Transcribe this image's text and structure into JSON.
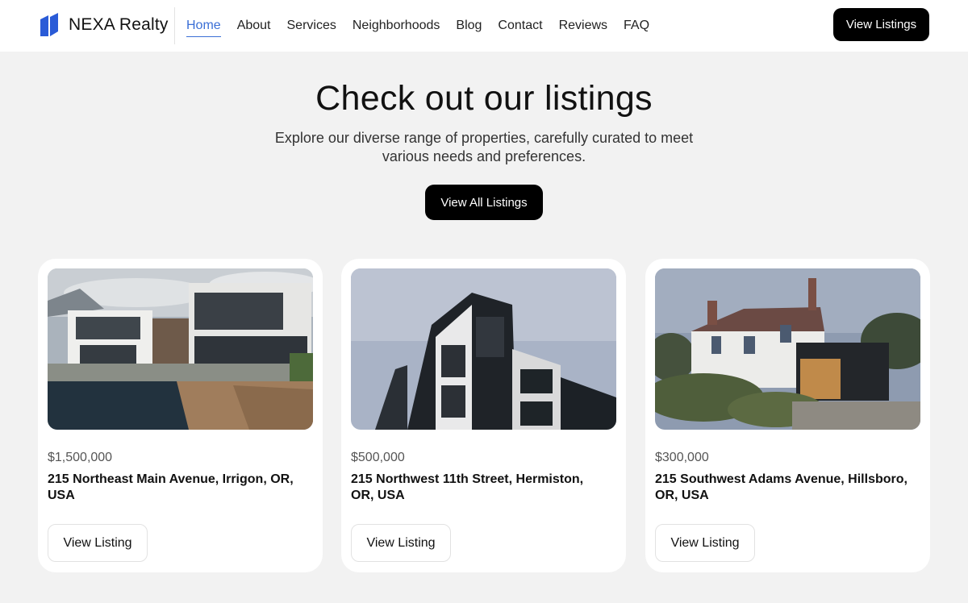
{
  "header": {
    "brand": "NEXA Realty",
    "logo_icon": "nexa-logo-icon",
    "nav": [
      {
        "label": "Home",
        "active": true
      },
      {
        "label": "About"
      },
      {
        "label": "Services"
      },
      {
        "label": "Neighborhoods"
      },
      {
        "label": "Blog"
      },
      {
        "label": "Contact"
      },
      {
        "label": "Reviews"
      },
      {
        "label": "FAQ"
      }
    ],
    "cta_label": "View Listings"
  },
  "hero": {
    "title": "Check out our listings",
    "subtitle": "Explore our diverse range of properties, carefully curated to meet various needs and preferences.",
    "cta_label": "View All Listings"
  },
  "listings": [
    {
      "price": "$1,500,000",
      "address": "215 Northeast Main Avenue, Irrigon, OR, USA",
      "button_label": "View Listing",
      "image": "modern-villa-with-pool-photo"
    },
    {
      "price": "$500,000",
      "address": "215 Northwest 11th Street, Hermiston, OR, USA",
      "button_label": "View Listing",
      "image": "modern-apartment-building-photo"
    },
    {
      "price": "$300,000",
      "address": "215 Southwest Adams Avenue, Hillsboro, OR, USA",
      "button_label": "View Listing",
      "image": "white-cottage-with-garden-photo"
    }
  ],
  "colors": {
    "accent": "#3b6fd6",
    "logo": "#2a5bd7",
    "background": "#f2f2f2",
    "button_dark": "#000000"
  }
}
